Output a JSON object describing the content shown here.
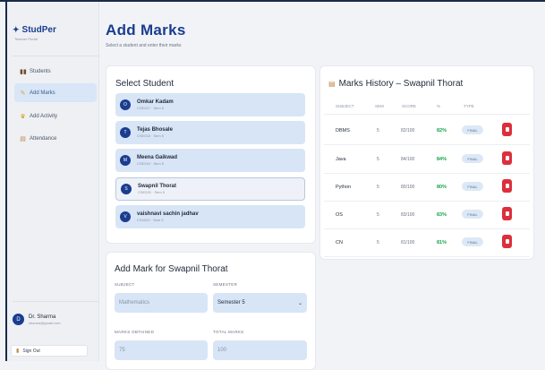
{
  "app": {
    "logo": "StudPer",
    "logo_sub": "Teacher Portal"
  },
  "nav": [
    {
      "label": "Students",
      "icon": "students-icon",
      "active": false
    },
    {
      "label": "Add Marks",
      "icon": "pencil-icon",
      "active": true
    },
    {
      "label": "Add Activity",
      "icon": "trophy-icon",
      "active": false
    },
    {
      "label": "Attendance",
      "icon": "clipboard-icon",
      "active": false
    }
  ],
  "user": {
    "initial": "D",
    "name": "Dr. Sharma",
    "email": "sharma@gmail.com"
  },
  "signout": "Sign Out",
  "page": {
    "title": "Add Marks",
    "subtitle": "Select a student and enter their marks"
  },
  "select_student": {
    "title": "Select Student",
    "students": [
      {
        "initial": "O",
        "name": "Omkar Kadam",
        "meta": "CSE017 · Sem 5"
      },
      {
        "initial": "T",
        "name": "Tejas Bhosale",
        "meta": "CSE018 · Sem 5"
      },
      {
        "initial": "M",
        "name": "Meena Gaikwad",
        "meta": "CSE019 · Sem 5"
      },
      {
        "initial": "S",
        "name": "Swapnil Thorat",
        "meta": "CSE020 · Sem 5"
      },
      {
        "initial": "V",
        "name": "vaishnavi sachin jadhav",
        "meta": "CS4023 · Sem 5"
      }
    ]
  },
  "history": {
    "title": "Marks History – Swapnil Thorat",
    "columns": [
      "SUBJECT",
      "SEM",
      "SCORE",
      "%",
      "TYPE"
    ],
    "rows": [
      {
        "subject": "DBMS",
        "sem": "5",
        "score": "82/100",
        "pct": "82%",
        "type": "FINAL"
      },
      {
        "subject": "Java",
        "sem": "5",
        "score": "84/100",
        "pct": "84%",
        "type": "FINAL"
      },
      {
        "subject": "Python",
        "sem": "5",
        "score": "80/100",
        "pct": "80%",
        "type": "FINAL"
      },
      {
        "subject": "OS",
        "sem": "5",
        "score": "83/100",
        "pct": "83%",
        "type": "FINAL"
      },
      {
        "subject": "CN",
        "sem": "5",
        "score": "81/100",
        "pct": "81%",
        "type": "FINAL"
      }
    ]
  },
  "form": {
    "title": "Add Mark for Swapnil Thorat",
    "subject_label": "SUBJECT",
    "subject_placeholder": "Mathematics",
    "semester_label": "SEMESTER",
    "semester_value": "Semester 5",
    "obtained_label": "MARKS OBTAINED",
    "obtained_placeholder": "75",
    "total_label": "TOTAL MARKS",
    "total_placeholder": "100"
  },
  "colors": {
    "brand": "#1a3d8f",
    "accent": "#d7e5f6",
    "danger": "#dc2f3c",
    "success": "#16a34a"
  }
}
